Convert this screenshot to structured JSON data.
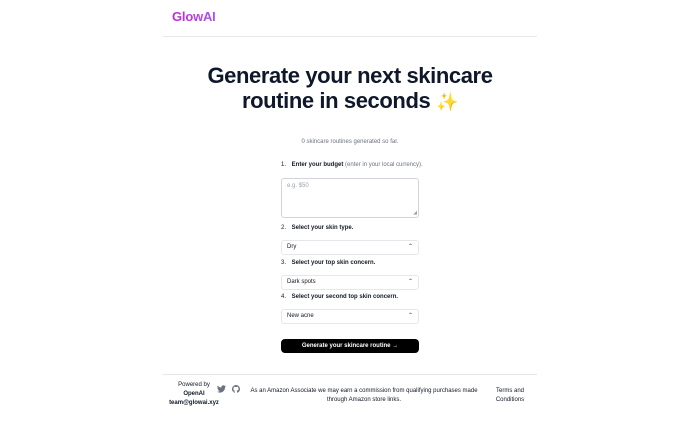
{
  "header": {
    "logo": "GlowAI"
  },
  "hero": {
    "title": "Generate your next skincare routine in seconds",
    "sparkle": "✨",
    "counter": "0 skincare routines generated so far."
  },
  "form": {
    "step1": {
      "num": "1.",
      "label": "Enter your budget",
      "hint": "(enter in your local currency)."
    },
    "budget_placeholder": "e.g. $50",
    "step2": {
      "num": "2.",
      "label": "Select your skin type."
    },
    "skin_type": "Dry",
    "step3": {
      "num": "3.",
      "label": "Select your top skin concern."
    },
    "top_concern": "Dark spots",
    "step4": {
      "num": "4.",
      "label": "Select your second top skin concern."
    },
    "second_concern": "New acne",
    "submit": "Generate your skincare routine →"
  },
  "footer": {
    "powered_by": "Powered by",
    "provider": "OpenAI",
    "email": "team@glowai.xyz",
    "affiliate": "As an Amazon Associate we may earn a commission from qualifying purchases made through Amazon store links.",
    "terms": "Terms and Conditions"
  },
  "icons": {
    "twitter": "twitter-icon",
    "github": "github-icon",
    "chevron": "chevron-up-icon"
  },
  "colors": {
    "brand": "#c026d3",
    "button": "#000000"
  }
}
